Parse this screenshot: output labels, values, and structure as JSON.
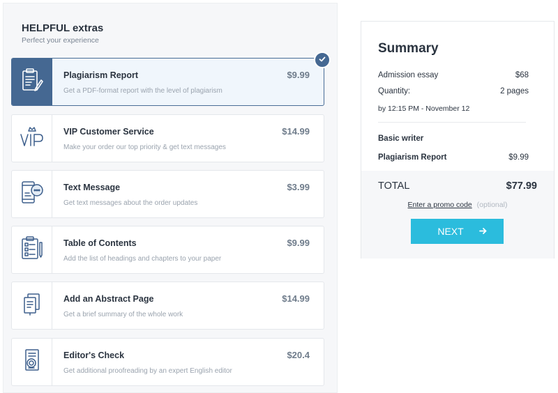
{
  "extras": {
    "title": "HELPFUL extras",
    "subtitle": "Perfect your experience",
    "items": [
      {
        "name": "Plagiarism Report",
        "description": "Get a PDF-format report with the level of plagiarism",
        "price": "$9.99",
        "icon": "clipboard-pencil-icon",
        "selected": true
      },
      {
        "name": "VIP Customer Service",
        "description": "Make your order our top priority & get text messages",
        "price": "$14.99",
        "icon": "vip-crown-icon",
        "selected": false
      },
      {
        "name": "Text Message",
        "description": "Get text messages about the order updates",
        "price": "$3.99",
        "icon": "phone-chat-icon",
        "selected": false
      },
      {
        "name": "Table of Contents",
        "description": "Add the list of headings and chapters to your paper",
        "price": "$9.99",
        "icon": "checklist-clipboard-icon",
        "selected": false
      },
      {
        "name": "Add an Abstract Page",
        "description": "Get a brief summary of the whole work",
        "price": "$14.99",
        "icon": "document-pages-icon",
        "selected": false
      },
      {
        "name": "Editor's Check",
        "description": "Get additional proofreading by an expert English editor",
        "price": "$20.4",
        "icon": "document-magnifier-icon",
        "selected": false
      }
    ]
  },
  "summary": {
    "title": "Summary",
    "paper_type": "Admission essay",
    "paper_price": "$68",
    "quantity_label": "Quantity:",
    "quantity_value": "2 pages",
    "deadline": "by 12:15 PM - November 12",
    "writer": "Basic writer",
    "extra_name": "Plagiarism Report",
    "extra_price": "$9.99",
    "total_label": "TOTAL",
    "total_value": "$77.99",
    "promo_link": "Enter a promo code",
    "promo_optional": "(optional)",
    "next_label": "NEXT"
  },
  "colors": {
    "accent": "#2bbcdd",
    "selected_blue": "#456892",
    "icon_blue": "#3d5f8c"
  }
}
